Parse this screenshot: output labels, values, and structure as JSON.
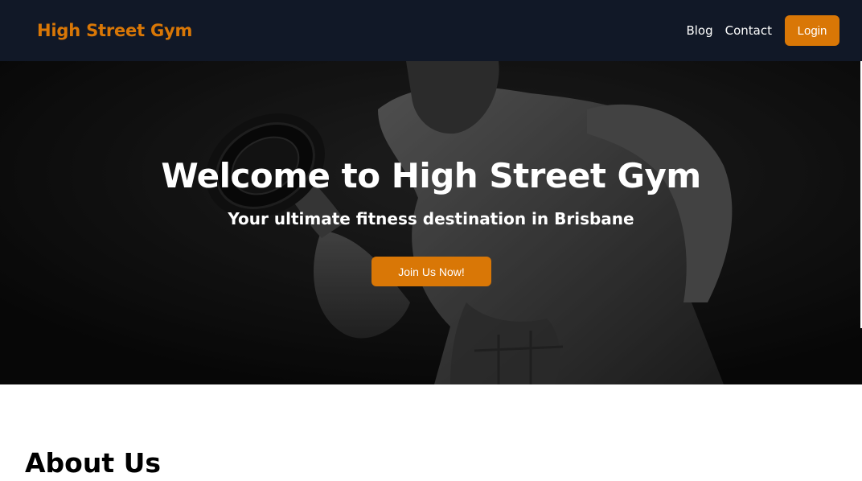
{
  "nav": {
    "brand": "High Street Gym",
    "links": [
      {
        "label": "Blog"
      },
      {
        "label": "Contact"
      }
    ],
    "login_label": "Login"
  },
  "hero": {
    "title": "Welcome to High Street Gym",
    "subtitle": "Your ultimate fitness destination in Brisbane",
    "cta_label": "Join Us Now!",
    "image": "bodybuilder-curling-dumbbell"
  },
  "about": {
    "title": "About Us"
  },
  "colors": {
    "accent": "#d97706",
    "nav_bg": "#111827",
    "hero_bg": "#0b0b0b"
  }
}
